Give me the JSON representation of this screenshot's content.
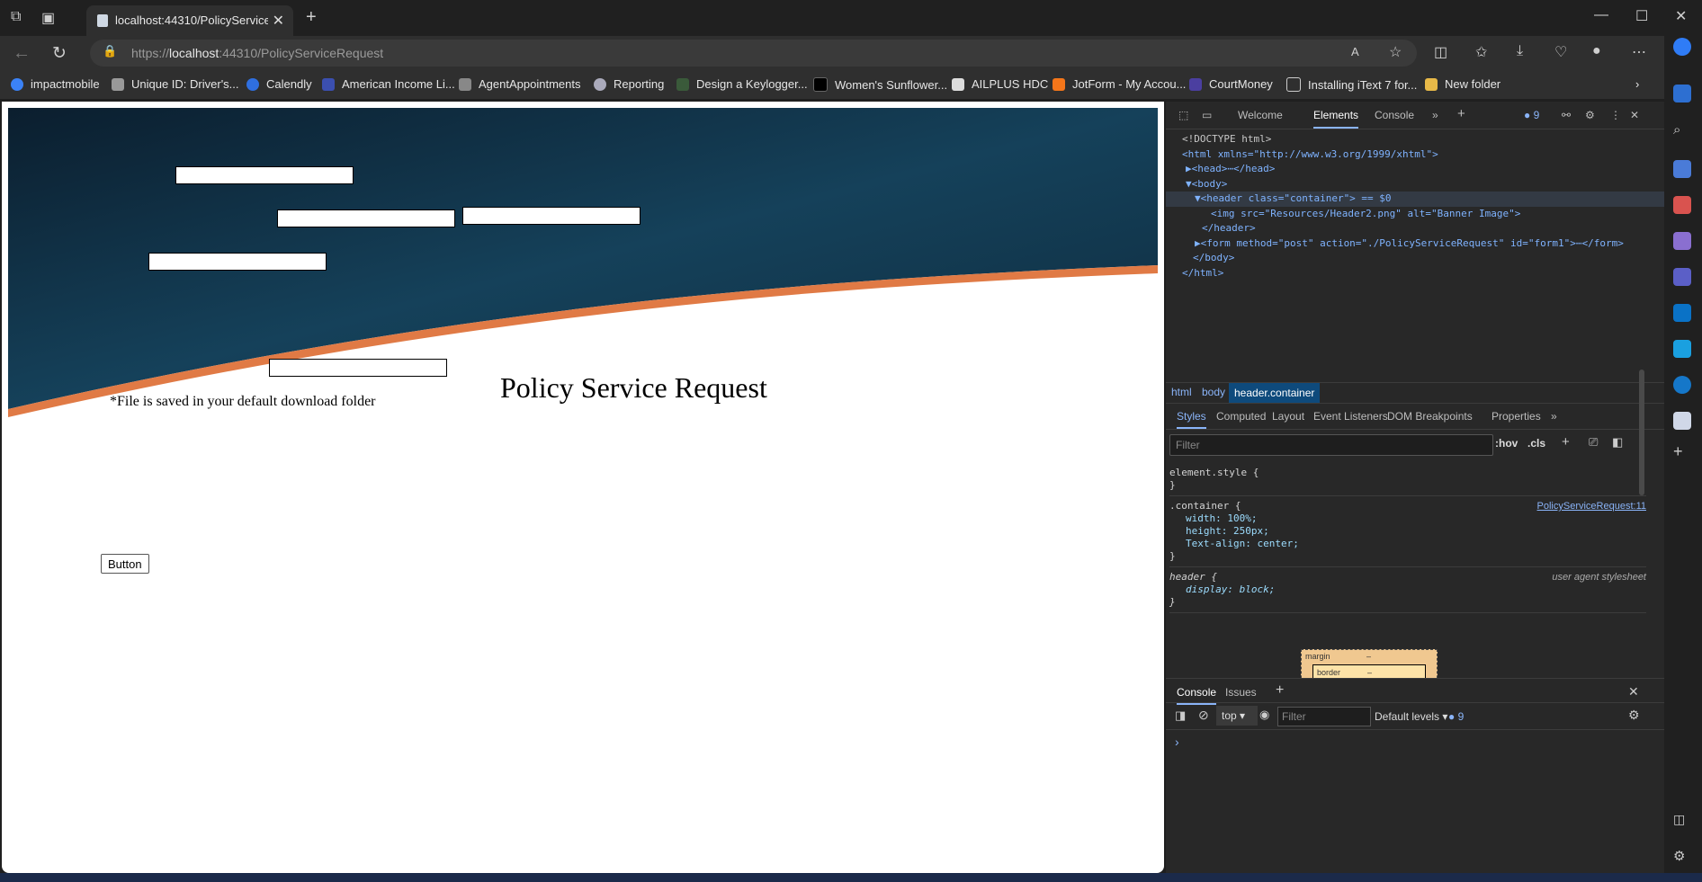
{
  "browser": {
    "tab_title": "localhost:44310/PolicyServiceRequ",
    "url_scheme": "https://",
    "url_host": "localhost",
    "url_rest": ":44310/PolicyServiceRequest",
    "bookmarks": [
      "impactmobile",
      "Unique ID: Driver's...",
      "Calendly",
      "American Income Li...",
      "AgentAppointments",
      "Reporting",
      "Design a Keylogger...",
      "Women's Sunflower...",
      "AILPLUS HDC",
      "JotForm - My Accou...",
      "CourtMoney",
      "Installing iText 7 for...",
      "New folder"
    ]
  },
  "page": {
    "heading": "Policy Service Request",
    "note": "*File is saved in your default download folder",
    "button_label": "Button"
  },
  "devtools": {
    "tabs": [
      "Welcome",
      "Elements",
      "Console"
    ],
    "issues_count": "9",
    "dom_lines": [
      "<!DOCTYPE html>",
      "<html xmlns=\"http://www.w3.org/1999/xhtml\">",
      "▶<head>⋯</head>",
      "▼<body>",
      "▼<header class=\"container\"> == $0",
      "<img src=\"Resources/Header2.png\" alt=\"Banner Image\">",
      "</header>",
      "▶<form method=\"post\" action=\"./PolicyServiceRequest\" id=\"form1\">⋯</form>",
      "</body>",
      "</html>"
    ],
    "breadcrumbs": [
      "html",
      "body",
      "header.container"
    ],
    "subtabs": [
      "Styles",
      "Computed",
      "Layout",
      "Event Listeners",
      "DOM Breakpoints",
      "Properties"
    ],
    "filter_placeholder": "Filter",
    "hov": ":hov",
    "cls": ".cls",
    "styles": {
      "element_style": "element.style {",
      "close": "}",
      "container_selector": ".container {",
      "container_source": "PolicyServiceRequest:11",
      "container_props": [
        "width: 100%;",
        "height: 250px;",
        "Text-align: center;"
      ],
      "header_selector": "header {",
      "header_source": "user agent stylesheet",
      "header_props": [
        "display: block;"
      ]
    },
    "boxmodel": {
      "margin": "margin",
      "border": "border",
      "dash": "–"
    },
    "console": {
      "tabs": [
        "Console",
        "Issues"
      ],
      "context": "top",
      "filter_placeholder": "Filter",
      "levels": "Default levels",
      "count": "9",
      "prompt": "›"
    }
  }
}
